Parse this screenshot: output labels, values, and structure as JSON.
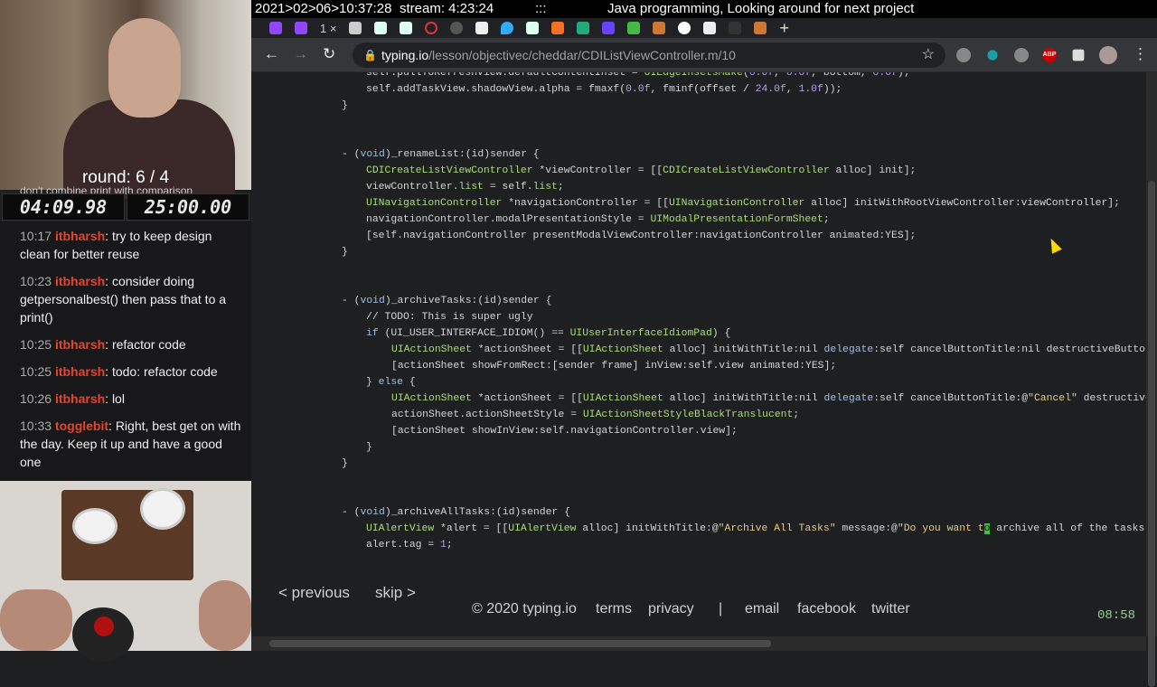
{
  "overlay": {
    "round": "round: 6 / 4",
    "clipped_chat": "don't combine print with comparison",
    "timer_elapsed": "04:09.98",
    "timer_total": "25:00.00",
    "chat": [
      {
        "time": "10:17",
        "user": "itbharsh",
        "text": ": try to keep design clean for better reuse"
      },
      {
        "time": "10:23",
        "user": "itbharsh",
        "text": ": consider doing getpersonalbest() then pass that to a print()"
      },
      {
        "time": "10:25",
        "user": "itbharsh",
        "text": ": refactor code"
      },
      {
        "time": "10:25",
        "user": "itbharsh",
        "text": ": todo: refactor code"
      },
      {
        "time": "10:26",
        "user": "itbharsh",
        "text": ": lol"
      },
      {
        "time": "10:33",
        "user": "togglebit",
        "text": ": Right, best get on with the day. Keep it up and have a good one"
      }
    ]
  },
  "stream_bar": {
    "datetime": "2021>02>06>10:37:28",
    "uptime": "stream: 4:23:24",
    "sep": ":::",
    "title": "Java programming, Looking around for next project"
  },
  "browser": {
    "active_tab": "1",
    "close": "×",
    "new_tab": "+",
    "url_host": "typing.io",
    "url_path": "/lesson/objectivec/cheddar/CDIListViewController.m/10",
    "back": "←",
    "forward": "→",
    "reload": "↻",
    "star": "☆",
    "abp": "ABP",
    "menu": "⋮"
  },
  "code": [
    {
      "i": 1,
      "p": [
        [
          "m",
          "self.pullToRefreshView.defaultContentInset = "
        ],
        [
          "c",
          "UIEdgeInsetsMake"
        ],
        [
          "m",
          "("
        ],
        [
          "n",
          "0.0f"
        ],
        [
          "m",
          ", "
        ],
        [
          "n",
          "0.0f"
        ],
        [
          "m",
          ", bottom, "
        ],
        [
          "n",
          "0.0f"
        ],
        [
          "m",
          ");"
        ]
      ]
    },
    {
      "i": 1,
      "p": [
        [
          "m",
          "self.addTaskView.shadowView.alpha = fmaxf("
        ],
        [
          "n",
          "0.0f"
        ],
        [
          "m",
          ", fminf(offset / "
        ],
        [
          "n",
          "24.0f"
        ],
        [
          "m",
          ", "
        ],
        [
          "n",
          "1.0f"
        ],
        [
          "m",
          "));"
        ]
      ]
    },
    {
      "i": 0,
      "p": [
        [
          "m",
          "}"
        ]
      ]
    },
    {
      "i": 0,
      "p": []
    },
    {
      "i": 0,
      "p": []
    },
    {
      "i": 0,
      "p": [
        [
          "m",
          "- ("
        ],
        [
          "k",
          "void"
        ],
        [
          "m",
          ")_renameList:(id)sender {"
        ]
      ]
    },
    {
      "i": 1,
      "p": [
        [
          "c",
          "CDICreateListViewController"
        ],
        [
          "m",
          " *viewController = [["
        ],
        [
          "c",
          "CDICreateListViewController"
        ],
        [
          "m",
          " alloc] init];"
        ]
      ]
    },
    {
      "i": 1,
      "p": [
        [
          "m",
          "viewController."
        ],
        [
          "c",
          "list"
        ],
        [
          "m",
          " = self."
        ],
        [
          "c",
          "list"
        ],
        [
          "m",
          ";"
        ]
      ]
    },
    {
      "i": 1,
      "p": [
        [
          "c",
          "UINavigationController"
        ],
        [
          "m",
          " *navigationController = [["
        ],
        [
          "c",
          "UINavigationController"
        ],
        [
          "m",
          " alloc] initWithRootViewController:viewController];"
        ]
      ]
    },
    {
      "i": 1,
      "p": [
        [
          "m",
          "navigationController.modalPresentationStyle = "
        ],
        [
          "c",
          "UIModalPresentationFormSheet"
        ],
        [
          "m",
          ";"
        ]
      ]
    },
    {
      "i": 1,
      "p": [
        [
          "m",
          "[self.navigationController presentModalViewController:navigationController animated:YES];"
        ]
      ]
    },
    {
      "i": 0,
      "p": [
        [
          "m",
          "}"
        ]
      ]
    },
    {
      "i": 0,
      "p": []
    },
    {
      "i": 0,
      "p": []
    },
    {
      "i": 0,
      "p": [
        [
          "m",
          "- ("
        ],
        [
          "k",
          "void"
        ],
        [
          "m",
          ")_archiveTasks:(id)sender {"
        ]
      ]
    },
    {
      "i": 1,
      "p": [
        [
          "m",
          "// TODO: This is super ugly"
        ]
      ]
    },
    {
      "i": 1,
      "p": [
        [
          "k",
          "if"
        ],
        [
          "m",
          " (UI_USER_INTERFACE_IDIOM() == "
        ],
        [
          "c",
          "UIUserInterfaceIdiomPad"
        ],
        [
          "m",
          ") {"
        ]
      ]
    },
    {
      "i": 2,
      "p": [
        [
          "c",
          "UIActionSheet"
        ],
        [
          "m",
          " *actionSheet = [["
        ],
        [
          "c",
          "UIActionSheet"
        ],
        [
          "m",
          " alloc] initWithTitle:nil "
        ],
        [
          "k",
          "delegate"
        ],
        [
          "m",
          ":self cancelButtonTitle:nil destructiveButtonTitle:nil"
        ]
      ]
    },
    {
      "i": 2,
      "p": [
        [
          "m",
          "[actionSheet showFromRect:[sender frame] inView:self.view animated:YES];"
        ]
      ]
    },
    {
      "i": 1,
      "p": [
        [
          "m",
          "} "
        ],
        [
          "k",
          "else"
        ],
        [
          "m",
          " {"
        ]
      ]
    },
    {
      "i": 2,
      "p": [
        [
          "c",
          "UIActionSheet"
        ],
        [
          "m",
          " *actionSheet = [["
        ],
        [
          "c",
          "UIActionSheet"
        ],
        [
          "m",
          " alloc] initWithTitle:nil "
        ],
        [
          "k",
          "delegate"
        ],
        [
          "m",
          ":self cancelButtonTitle:@"
        ],
        [
          "s",
          "\"Cancel\""
        ],
        [
          "m",
          " destructiveButtonTitle:nil"
        ]
      ]
    },
    {
      "i": 2,
      "p": [
        [
          "m",
          "actionSheet.actionSheetStyle = "
        ],
        [
          "c",
          "UIActionSheetStyleBlackTranslucent"
        ],
        [
          "m",
          ";"
        ]
      ]
    },
    {
      "i": 2,
      "p": [
        [
          "m",
          "[actionSheet showInView:self.navigationController.view];"
        ]
      ]
    },
    {
      "i": 1,
      "p": [
        [
          "m",
          "}"
        ]
      ]
    },
    {
      "i": 0,
      "p": [
        [
          "m",
          "}"
        ]
      ]
    },
    {
      "i": 0,
      "p": []
    },
    {
      "i": 0,
      "p": []
    },
    {
      "i": 0,
      "p": [
        [
          "m",
          "- ("
        ],
        [
          "k",
          "void"
        ],
        [
          "m",
          ")_archiveAllTasks:(id)sender {"
        ]
      ]
    },
    {
      "i": 1,
      "p": [
        [
          "c",
          "UIAlertView"
        ],
        [
          "m",
          " *alert = [["
        ],
        [
          "c",
          "UIAlertView"
        ],
        [
          "m",
          " alloc] initWithTitle:@"
        ],
        [
          "s",
          "\"Archive All Tasks\""
        ],
        [
          "m",
          " message:@"
        ],
        [
          "s",
          "\"Do you want t"
        ],
        [
          "cur",
          "o"
        ],
        [
          "m",
          " archive all of the tasks\""
        ]
      ]
    },
    {
      "i": 1,
      "p": [
        [
          "m",
          "alert.tag = "
        ],
        [
          "n",
          "1"
        ],
        [
          "m",
          ";"
        ]
      ]
    }
  ],
  "footer": {
    "previous": "< previous",
    "skip": "skip >",
    "copyright": "© 2020 typing.io",
    "terms": "terms",
    "privacy": "privacy",
    "sep": "|",
    "email": "email",
    "facebook": "facebook",
    "twitter": "twitter",
    "timer": "08:58"
  },
  "colors": {
    "class": "#a9dc76",
    "number": "#b99cf0",
    "string": "#e3c98a",
    "keyword": "#a3bde6",
    "cursor": "#3ec23e",
    "timer": "#8fd18f"
  }
}
